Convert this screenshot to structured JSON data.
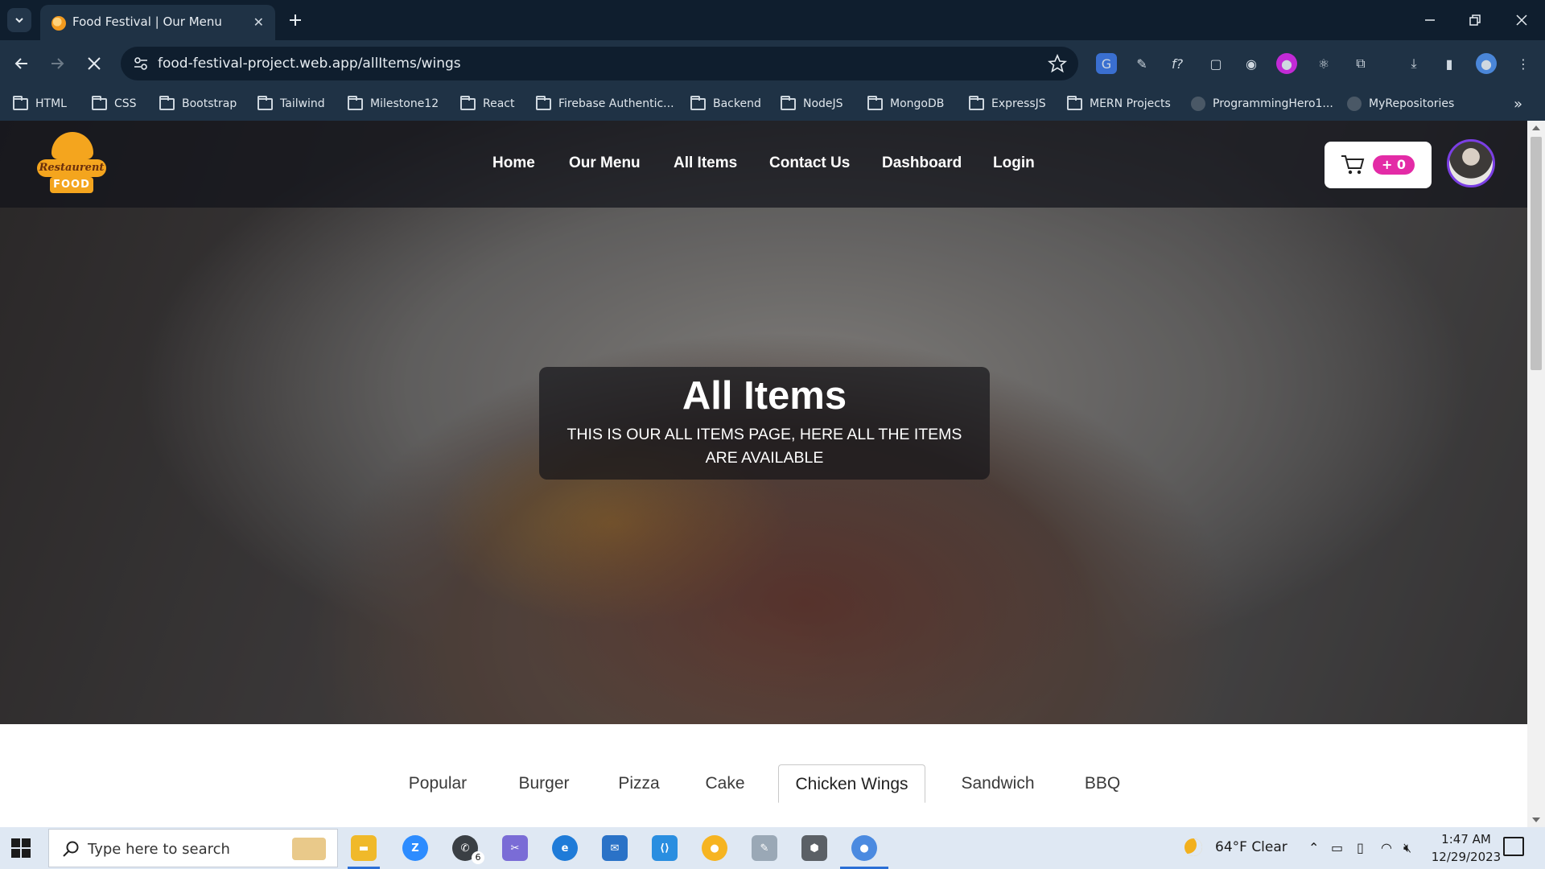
{
  "browser": {
    "tab_title": "Food Festival | Our Menu",
    "url": "food-festival-project.web.app/allItems/wings",
    "bookmarks": [
      {
        "label": "HTML",
        "icon": "folder-icon"
      },
      {
        "label": "CSS",
        "icon": "folder-icon"
      },
      {
        "label": "Bootstrap",
        "icon": "folder-icon"
      },
      {
        "label": "Tailwind",
        "icon": "folder-icon"
      },
      {
        "label": "Milestone12",
        "icon": "folder-icon"
      },
      {
        "label": "React",
        "icon": "folder-icon"
      },
      {
        "label": "Firebase Authentic...",
        "icon": "folder-icon"
      },
      {
        "label": "Backend",
        "icon": "folder-icon"
      },
      {
        "label": "NodeJS",
        "icon": "folder-icon"
      },
      {
        "label": "MongoDB",
        "icon": "folder-icon"
      },
      {
        "label": "ExpressJS",
        "icon": "folder-icon"
      },
      {
        "label": "MERN Projects",
        "icon": "folder-icon"
      },
      {
        "label": "ProgrammingHero1...",
        "icon": "github-icon"
      },
      {
        "label": "MyRepositories",
        "icon": "github-icon"
      }
    ],
    "more_bookmarks": "»"
  },
  "site": {
    "logo_text_1": "Restaurent",
    "logo_text_2": "FOOD",
    "nav": [
      {
        "label": "Home"
      },
      {
        "label": "Our Menu"
      },
      {
        "label": "All Items"
      },
      {
        "label": "Contact Us"
      },
      {
        "label": "Dashboard"
      },
      {
        "label": "Login"
      }
    ],
    "cart_count": "+ 0",
    "accent_color": "#e32ba6"
  },
  "hero": {
    "title": "All Items",
    "subtitle": "THIS IS OUR ALL ITEMS PAGE, HERE ALL THE ITEMS ARE AVAILABLE"
  },
  "categories": {
    "tabs": [
      {
        "label": "Popular"
      },
      {
        "label": "Burger"
      },
      {
        "label": "Pizza"
      },
      {
        "label": "Cake"
      },
      {
        "label": "Chicken Wings"
      },
      {
        "label": "Sandwich"
      },
      {
        "label": "BBQ"
      }
    ],
    "selected": "Chicken Wings"
  },
  "taskbar": {
    "search_placeholder": "Type here to search",
    "whatsapp_badge": "6",
    "weather": "64°F  Clear",
    "time": "1:47 AM",
    "date": "12/29/2023"
  }
}
